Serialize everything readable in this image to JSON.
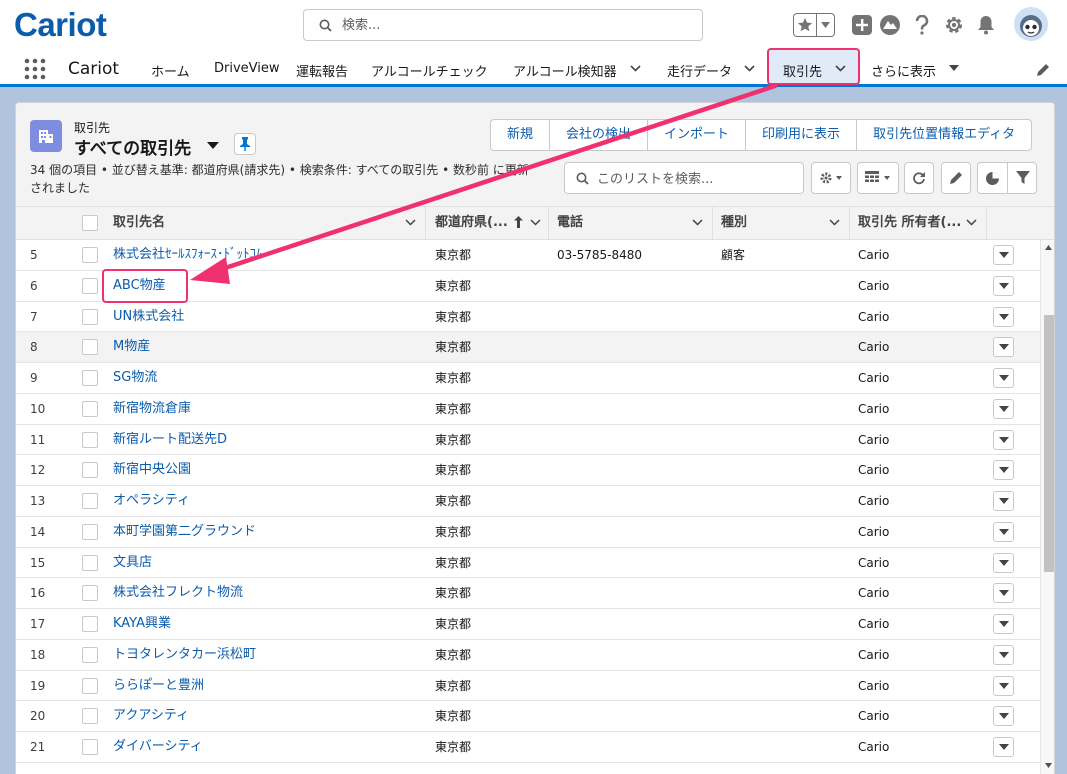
{
  "header": {
    "logo": "Cariot",
    "search_placeholder": "検索...",
    "icons": [
      "favorites-star-icon",
      "add-icon",
      "trailhead-icon",
      "help-icon",
      "setup-gear-icon",
      "notification-bell-icon",
      "user-avatar"
    ]
  },
  "nav": {
    "app_name": "Cariot",
    "items": [
      {
        "label": "ホーム",
        "has_menu": false
      },
      {
        "label": "DriveView",
        "has_menu": false
      },
      {
        "label": "運転報告",
        "has_menu": false
      },
      {
        "label": "アルコールチェック",
        "has_menu": false
      },
      {
        "label": "アルコール検知器",
        "has_menu": true
      },
      {
        "label": "走行データ",
        "has_menu": true
      }
    ],
    "active_tab": "取引先",
    "more": "さらに表示"
  },
  "list": {
    "object_label": "取引先",
    "list_name": "すべての取引先",
    "meta": "34 個の項目 • 並び替え基準: 都道府県(請求先) • 検索条件: すべての取引先 • 数秒前 に更新されました",
    "actions": [
      "新規",
      "会社の検出",
      "インポート",
      "印刷用に表示",
      "取引先位置情報エディタ"
    ],
    "search_placeholder": "このリストを検索...",
    "columns": {
      "name": "取引先名",
      "prefecture": "都道府県(...",
      "phone": "電話",
      "type": "種別",
      "owner": "取引先 所有者(..."
    }
  },
  "rows": [
    {
      "num": "5",
      "name": "株式会社ｾｰﾙｽﾌｫｰｽ･ﾄﾞｯﾄｺﾑ",
      "pref": "東京都",
      "phone": "03-5785-8480",
      "type": "顧客",
      "owner": "Cario"
    },
    {
      "num": "6",
      "name": "ABC物産",
      "pref": "東京都",
      "phone": "",
      "type": "",
      "owner": "Cario"
    },
    {
      "num": "7",
      "name": "UN株式会社",
      "pref": "東京都",
      "phone": "",
      "type": "",
      "owner": "Cario"
    },
    {
      "num": "8",
      "name": "M物産",
      "pref": "東京都",
      "phone": "",
      "type": "",
      "owner": "Cario"
    },
    {
      "num": "9",
      "name": "SG物流",
      "pref": "東京都",
      "phone": "",
      "type": "",
      "owner": "Cario"
    },
    {
      "num": "10",
      "name": "新宿物流倉庫",
      "pref": "東京都",
      "phone": "",
      "type": "",
      "owner": "Cario"
    },
    {
      "num": "11",
      "name": "新宿ルート配送先D",
      "pref": "東京都",
      "phone": "",
      "type": "",
      "owner": "Cario"
    },
    {
      "num": "12",
      "name": "新宿中央公園",
      "pref": "東京都",
      "phone": "",
      "type": "",
      "owner": "Cario"
    },
    {
      "num": "13",
      "name": "オペラシティ",
      "pref": "東京都",
      "phone": "",
      "type": "",
      "owner": "Cario"
    },
    {
      "num": "14",
      "name": "本町学園第二グラウンド",
      "pref": "東京都",
      "phone": "",
      "type": "",
      "owner": "Cario"
    },
    {
      "num": "15",
      "name": "文具店",
      "pref": "東京都",
      "phone": "",
      "type": "",
      "owner": "Cario"
    },
    {
      "num": "16",
      "name": "株式会社フレクト物流",
      "pref": "東京都",
      "phone": "",
      "type": "",
      "owner": "Cario"
    },
    {
      "num": "17",
      "name": "KAYA興業",
      "pref": "東京都",
      "phone": "",
      "type": "",
      "owner": "Cario"
    },
    {
      "num": "18",
      "name": "トヨタレンタカー浜松町",
      "pref": "東京都",
      "phone": "",
      "type": "",
      "owner": "Cario"
    },
    {
      "num": "19",
      "name": "ららぽーと豊洲",
      "pref": "東京都",
      "phone": "",
      "type": "",
      "owner": "Cario"
    },
    {
      "num": "20",
      "name": "アクアシティ",
      "pref": "東京都",
      "phone": "",
      "type": "",
      "owner": "Cario"
    },
    {
      "num": "21",
      "name": "ダイバーシティ",
      "pref": "東京都",
      "phone": "",
      "type": "",
      "owner": "Cario"
    }
  ],
  "colors": {
    "brand": "#0b5cab",
    "annotation": "#f0316f",
    "nav_border": "#0176d3"
  }
}
